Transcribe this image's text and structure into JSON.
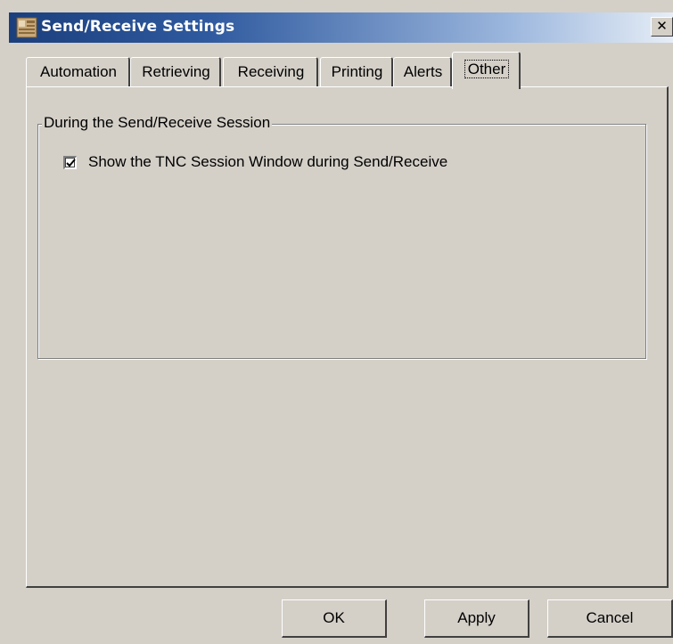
{
  "window": {
    "title": "Send/Receive Settings",
    "close_glyph": "✕"
  },
  "tabs": [
    {
      "label": "Automation",
      "active": false
    },
    {
      "label": "Retrieving",
      "active": false
    },
    {
      "label": "Receiving",
      "active": false
    },
    {
      "label": "Printing",
      "active": false
    },
    {
      "label": "Alerts",
      "active": false
    },
    {
      "label": "Other",
      "active": true
    }
  ],
  "group": {
    "legend": "During the Send/Receive Session",
    "checkbox": {
      "label": "Show the TNC Session Window during Send/Receive",
      "checked": true
    }
  },
  "buttons": {
    "ok": "OK",
    "apply": "Apply",
    "cancel": "Cancel"
  },
  "colors": {
    "face": "#d4d0c8",
    "title_start": "#1b3f7d",
    "title_end": "#e6edf6"
  }
}
